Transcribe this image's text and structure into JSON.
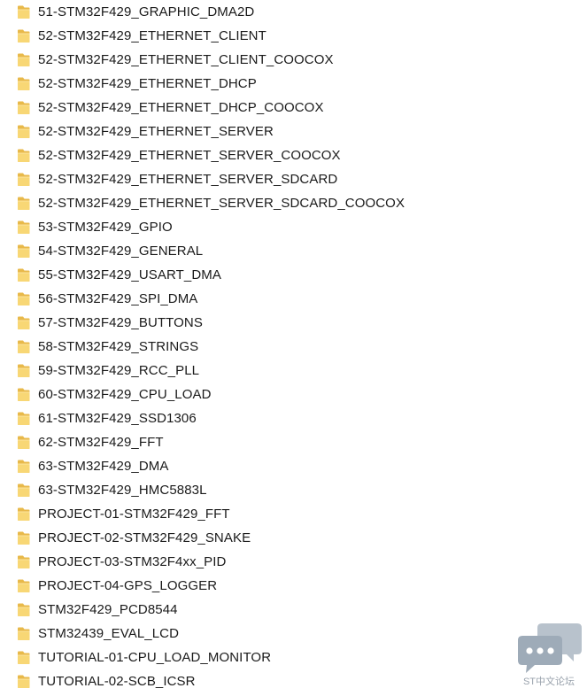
{
  "folders": [
    "51-STM32F429_GRAPHIC_DMA2D",
    "52-STM32F429_ETHERNET_CLIENT",
    "52-STM32F429_ETHERNET_CLIENT_COOCOX",
    "52-STM32F429_ETHERNET_DHCP",
    "52-STM32F429_ETHERNET_DHCP_COOCOX",
    "52-STM32F429_ETHERNET_SERVER",
    "52-STM32F429_ETHERNET_SERVER_COOCOX",
    "52-STM32F429_ETHERNET_SERVER_SDCARD",
    "52-STM32F429_ETHERNET_SERVER_SDCARD_COOCOX",
    "53-STM32F429_GPIO",
    "54-STM32F429_GENERAL",
    "55-STM32F429_USART_DMA",
    "56-STM32F429_SPI_DMA",
    "57-STM32F429_BUTTONS",
    "58-STM32F429_STRINGS",
    "59-STM32F429_RCC_PLL",
    "60-STM32F429_CPU_LOAD",
    "61-STM32F429_SSD1306",
    "62-STM32F429_FFT",
    "63-STM32F429_DMA",
    "63-STM32F429_HMC5883L",
    "PROJECT-01-STM32F429_FFT",
    "PROJECT-02-STM32F429_SNAKE",
    "PROJECT-03-STM32F4xx_PID",
    "PROJECT-04-GPS_LOGGER",
    "STM32F429_PCD8544",
    "STM32439_EVAL_LCD",
    "TUTORIAL-01-CPU_LOAD_MONITOR",
    "TUTORIAL-02-SCB_ICSR"
  ],
  "folder_icon": "folder-icon",
  "watermark": {
    "text": "ST中文论坛",
    "icon": "chat-bubbles-icon"
  },
  "colors": {
    "folder_yellow": "#f8d775",
    "folder_dark": "#e8b94a",
    "text": "#1a1a1a",
    "watermark": "#9aa3ad"
  }
}
